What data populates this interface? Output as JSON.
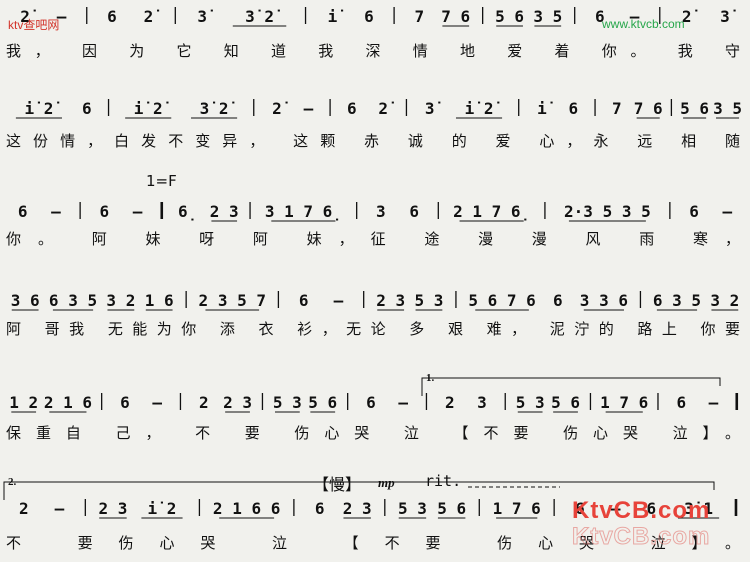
{
  "watermarks": {
    "top_left": "ktv查吧网",
    "top_right": "www.ktvcb.com",
    "logo": "KtvCB.com"
  },
  "key_label": "1=F",
  "ending_1": "1.",
  "ending_2": "2.",
  "tempo_mark": "【慢】",
  "dynamic": "mp",
  "ritardando": "rit.",
  "rows": [
    {
      "notes": [
        [
          "2̇",
          "–",
          "|",
          "6",
          "2̇",
          "|",
          "3̇",
          "3̇ 2̇",
          "|",
          "i̇",
          "6",
          "|",
          "7",
          "7 6",
          "|",
          "5 6",
          "3 5",
          "|",
          "6",
          "–",
          "|",
          "2̇",
          "3̇"
        ]
      ],
      "lyrics": "我，  因 为 它 知 道 我  深 情 地 爱  着 你。  我 守"
    },
    {
      "notes": [
        [
          "i̇ 2̇",
          "6",
          "|",
          "i̇ 2̇",
          "3̇ 2̇",
          "|",
          "2̇",
          "–",
          "|",
          "6",
          "2̇",
          "|",
          "3̇",
          "i̇ 2̇",
          "|",
          "i̇",
          "6",
          "|",
          "7",
          "7 6",
          "|",
          "5 6",
          "3 5"
        ]
      ],
      "lyrics": "这份情，白发不变异，  这颗  赤 诚 的 爱 心，永 远  相 随"
    },
    {
      "notes": [
        [
          "6",
          "–",
          "|",
          "6",
          "–",
          "‖:",
          "6̣",
          "2 3",
          "|",
          "3 1 7 6̣",
          "|",
          "3",
          "6",
          "|",
          "2 1 7 6̣",
          "|",
          "2·3 5 3 5",
          "|",
          "6",
          "–"
        ]
      ],
      "lyrics": "你。  阿 妹 呀 阿  妹，征 途 漫  漫 风 雨  寒，"
    },
    {
      "notes": [
        [
          "3 6",
          "6 3 5",
          "3 2",
          "1 6",
          "|",
          "2 3 5 7",
          "|",
          "6",
          "–",
          "|",
          "2 3",
          "5 3",
          "|",
          "5 6 7 6",
          "6",
          "3 3 6",
          "|",
          "6 3 5",
          "3 2"
        ]
      ],
      "lyrics": "阿  哥我 无能为你 添 衣  衫，无论 多  艰 难，  泥泞的 路上 你要"
    },
    {
      "notes": [
        [
          "1 2",
          "2 1 6",
          "|",
          "6",
          "–",
          "|",
          "2",
          "2 3",
          "|",
          "5 3",
          "5 6",
          "|",
          "6",
          "–",
          "|",
          "2",
          "3",
          "|",
          "5 3",
          "5 6",
          "|",
          "1 7 6",
          "|",
          "6",
          "–",
          "‖"
        ]
      ],
      "lyrics": "保重自  己， 不 要  伤心哭  泣 【不要  伤心哭   泣】。"
    },
    {
      "notes": [
        [
          "2",
          "–",
          "|",
          "2 3",
          "i̇ 2",
          "|",
          "2 1 6 6",
          "|",
          "6",
          "2 3",
          "|",
          "5 3",
          "5 6",
          "|",
          "1 7 6",
          "|",
          "6",
          "–",
          "6",
          "3̇ 1",
          "‖"
        ]
      ],
      "lyrics": "不  要伤心哭 泣  【不要 伤心哭    泣】。"
    }
  ]
}
